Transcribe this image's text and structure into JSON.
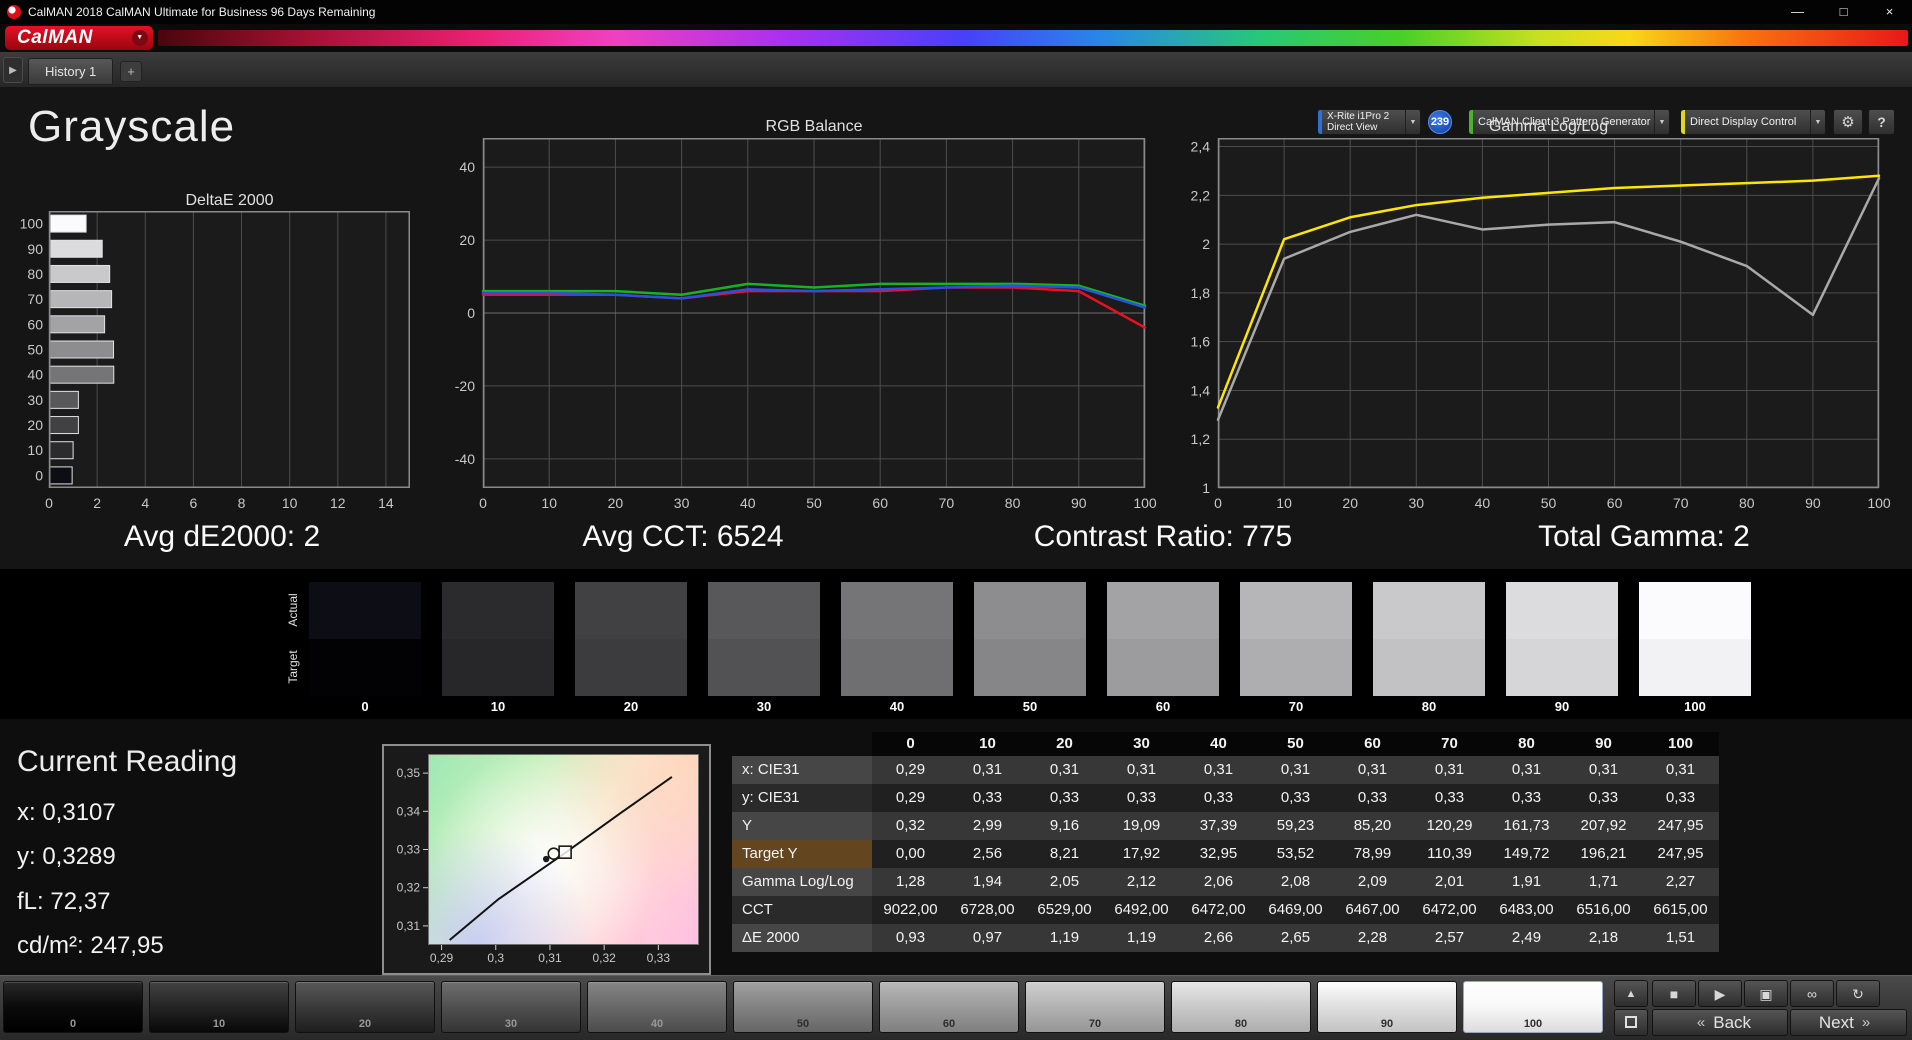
{
  "titlebar": {
    "title": "CalMAN 2018 CalMAN Ultimate for Business 96 Days Remaining"
  },
  "brand": {
    "logo": "CalMAN"
  },
  "icons": {
    "logo_caret": "▼",
    "dropdown": "▼",
    "expand": "▶",
    "minimize": "—",
    "maximize": "□",
    "close": "×",
    "gear": "⚙",
    "help": "?",
    "up": "▲",
    "stop": "■",
    "play": "▶",
    "pattern_window": "▣",
    "continuous": "∞",
    "refresh": "↻",
    "back_chevron": "«",
    "next_chevron": "»"
  },
  "tabbar": {
    "tab": "History 1",
    "add_tab": "+",
    "meter": {
      "line1": "X-Rite i1Pro 2",
      "line2": "Direct View"
    },
    "badge": "239",
    "source": "CalMAN Client 3 Pattern Generator",
    "display": "Direct Display Control"
  },
  "page": {
    "title": "Grayscale"
  },
  "summary": [
    "Avg dE2000: 2",
    "Avg CCT: 6524",
    "Contrast Ratio: 775",
    "Total Gamma: 2"
  ],
  "chart_data": [
    {
      "type": "bar",
      "title": "DeltaE 2000",
      "orientation": "horizontal",
      "categories": [
        100,
        90,
        80,
        70,
        60,
        50,
        40,
        30,
        20,
        10,
        0
      ],
      "values": [
        1.51,
        2.18,
        2.49,
        2.57,
        2.28,
        2.65,
        2.66,
        1.19,
        1.19,
        0.97,
        0.93
      ],
      "bar_colors": [
        "#fbfbfd",
        "#dcdcde",
        "#c9c9cb",
        "#b6b6b8",
        "#a3a3a5",
        "#8d8d8f",
        "#757577",
        "#58585a",
        "#414143",
        "#2b2b2d",
        "#0d0d15"
      ],
      "xlim": [
        0,
        15
      ],
      "x_ticks": [
        0,
        2,
        4,
        6,
        8,
        10,
        12,
        14
      ],
      "grid": true
    },
    {
      "type": "line",
      "title": "RGB Balance",
      "x": [
        0,
        10,
        20,
        30,
        40,
        50,
        60,
        70,
        80,
        90,
        100
      ],
      "x_ticks": [
        0,
        10,
        20,
        30,
        40,
        50,
        60,
        70,
        80,
        90,
        100
      ],
      "ylim": [
        -48,
        48
      ],
      "y_ticks": [
        "40",
        "20",
        "0",
        "-20",
        "-40"
      ],
      "y_tick_values": [
        40,
        20,
        0,
        -20,
        -40
      ],
      "grid": true,
      "series": [
        {
          "name": "red",
          "color": "#e81123",
          "values": [
            5,
            5,
            5,
            4,
            6,
            6,
            6,
            7,
            7,
            6,
            -4
          ]
        },
        {
          "name": "green",
          "color": "#17b325",
          "values": [
            6,
            6,
            6,
            5,
            8,
            7,
            8,
            8,
            8,
            7.5,
            2
          ]
        },
        {
          "name": "blue",
          "color": "#2b50e0",
          "values": [
            5.5,
            5.5,
            5,
            4,
            6.5,
            6,
            6.5,
            7,
            7.5,
            7,
            1.5
          ]
        }
      ]
    },
    {
      "type": "line",
      "title": "Gamma Log/Log",
      "x": [
        0,
        10,
        20,
        30,
        40,
        50,
        60,
        70,
        80,
        90,
        100
      ],
      "x_ticks": [
        0,
        10,
        20,
        30,
        40,
        50,
        60,
        70,
        80,
        90,
        100
      ],
      "ylim": [
        1.0,
        2.435
      ],
      "y_ticks": [
        "2,4",
        "2,2",
        "2",
        "1,8",
        "1,6",
        "1,4",
        "1,2",
        "1"
      ],
      "y_tick_values": [
        2.4,
        2.2,
        2.0,
        1.8,
        1.6,
        1.4,
        1.2,
        1.0
      ],
      "grid": true,
      "series": [
        {
          "name": "target gamma",
          "color": "#ffe600",
          "values": [
            1.33,
            2.02,
            2.11,
            2.16,
            2.19,
            2.21,
            2.23,
            2.24,
            2.25,
            2.26,
            2.28
          ]
        },
        {
          "name": "measured gamma",
          "color": "#a9a9a9",
          "values": [
            1.28,
            1.94,
            2.05,
            2.12,
            2.06,
            2.08,
            2.09,
            2.01,
            1.91,
            1.71,
            2.27
          ]
        }
      ]
    },
    {
      "type": "scatter",
      "title": "",
      "xlim": [
        0.2875,
        0.3375
      ],
      "ylim": [
        0.305,
        0.355
      ],
      "x_ticks": [
        "0,29",
        "0,3",
        "0,31",
        "0,32",
        "0,33"
      ],
      "x_tick_values": [
        0.29,
        0.3,
        0.31,
        0.32,
        0.33
      ],
      "y_ticks": [
        "0,35",
        "0,34",
        "0,33",
        "0,32",
        "0,31"
      ],
      "y_tick_values": [
        0.35,
        0.34,
        0.33,
        0.32,
        0.31
      ],
      "locus_line": [
        [
          0.2915,
          0.3063
        ],
        [
          0.3005,
          0.317
        ],
        [
          0.3127,
          0.329
        ],
        [
          0.323,
          0.3395
        ],
        [
          0.3325,
          0.349
        ]
      ],
      "points": [
        {
          "x": 0.3093,
          "y": 0.3275,
          "type": "dot"
        },
        {
          "x": 0.3107,
          "y": 0.3289,
          "type": "circle"
        },
        {
          "x": 0.3128,
          "y": 0.3293,
          "type": "square"
        }
      ]
    }
  ],
  "swatches": {
    "actual_label": "Actual",
    "target_label": "Target",
    "levels": [
      {
        "label": "0",
        "actual": "#0d0d15",
        "target": "#020204"
      },
      {
        "label": "10",
        "actual": "#2b2b2d",
        "target": "#272729"
      },
      {
        "label": "20",
        "actual": "#414143",
        "target": "#3c3c3e"
      },
      {
        "label": "30",
        "actual": "#58585a",
        "target": "#525254"
      },
      {
        "label": "40",
        "actual": "#757577",
        "target": "#6f6f71"
      },
      {
        "label": "50",
        "actual": "#8d8d8f",
        "target": "#868688"
      },
      {
        "label": "60",
        "actual": "#a3a3a5",
        "target": "#9c9c9e"
      },
      {
        "label": "70",
        "actual": "#b6b6b8",
        "target": "#aeaeb0"
      },
      {
        "label": "80",
        "actual": "#c9c9cb",
        "target": "#c2c2c4"
      },
      {
        "label": "90",
        "actual": "#dcdcde",
        "target": "#d6d6d8"
      },
      {
        "label": "100",
        "actual": "#fbfbfd",
        "target": "#f2f2f4"
      }
    ]
  },
  "reading": {
    "title": "Current Reading",
    "values": [
      "x: 0,3107",
      "y: 0,3289",
      "fL: 72,37",
      "cd/m²: 247,95"
    ]
  },
  "table": {
    "columns": [
      "0",
      "10",
      "20",
      "30",
      "40",
      "50",
      "60",
      "70",
      "80",
      "90",
      "100"
    ],
    "rows": [
      {
        "label": "x: CIE31",
        "values": [
          "0,29",
          "0,31",
          "0,31",
          "0,31",
          "0,31",
          "0,31",
          "0,31",
          "0,31",
          "0,31",
          "0,31",
          "0,31"
        ]
      },
      {
        "label": "y: CIE31",
        "values": [
          "0,29",
          "0,33",
          "0,33",
          "0,33",
          "0,33",
          "0,33",
          "0,33",
          "0,33",
          "0,33",
          "0,33",
          "0,33"
        ]
      },
      {
        "label": "Y",
        "values": [
          "0,32",
          "2,99",
          "9,16",
          "19,09",
          "37,39",
          "59,23",
          "85,20",
          "120,29",
          "161,73",
          "207,92",
          "247,95"
        ]
      },
      {
        "label": "Target Y",
        "highlight": true,
        "values": [
          "0,00",
          "2,56",
          "8,21",
          "17,92",
          "32,95",
          "53,52",
          "78,99",
          "110,39",
          "149,72",
          "196,21",
          "247,95"
        ]
      },
      {
        "label": "Gamma Log/Log",
        "values": [
          "1,28",
          "1,94",
          "2,05",
          "2,12",
          "2,06",
          "2,08",
          "2,09",
          "2,01",
          "1,91",
          "1,71",
          "2,27"
        ]
      },
      {
        "label": "CCT",
        "values": [
          "9022,00",
          "6728,00",
          "6529,00",
          "6492,00",
          "6472,00",
          "6469,00",
          "6467,00",
          "6472,00",
          "6483,00",
          "6516,00",
          "6615,00"
        ]
      },
      {
        "label": "ΔE 2000",
        "values": [
          "0,93",
          "0,97",
          "1,19",
          "1,19",
          "2,66",
          "2,65",
          "2,28",
          "2,57",
          "2,49",
          "2,18",
          "1,51"
        ]
      }
    ]
  },
  "toolbar": {
    "levels": [
      {
        "label": "0",
        "color": "#0a0a0a"
      },
      {
        "label": "10",
        "color": "#242424"
      },
      {
        "label": "20",
        "color": "#3a3a3a"
      },
      {
        "label": "30",
        "color": "#505050"
      },
      {
        "label": "40",
        "color": "#686868"
      },
      {
        "label": "50",
        "color": "#828282"
      },
      {
        "label": "60",
        "color": "#9b9b9b"
      },
      {
        "label": "70",
        "color": "#b2b2b2"
      },
      {
        "label": "80",
        "color": "#c9c9c9"
      },
      {
        "label": "90",
        "color": "#dfdfdf"
      },
      {
        "label": "100",
        "color": "#f8f8f8"
      }
    ],
    "selected_level": "100",
    "back": "Back",
    "next": "Next"
  }
}
